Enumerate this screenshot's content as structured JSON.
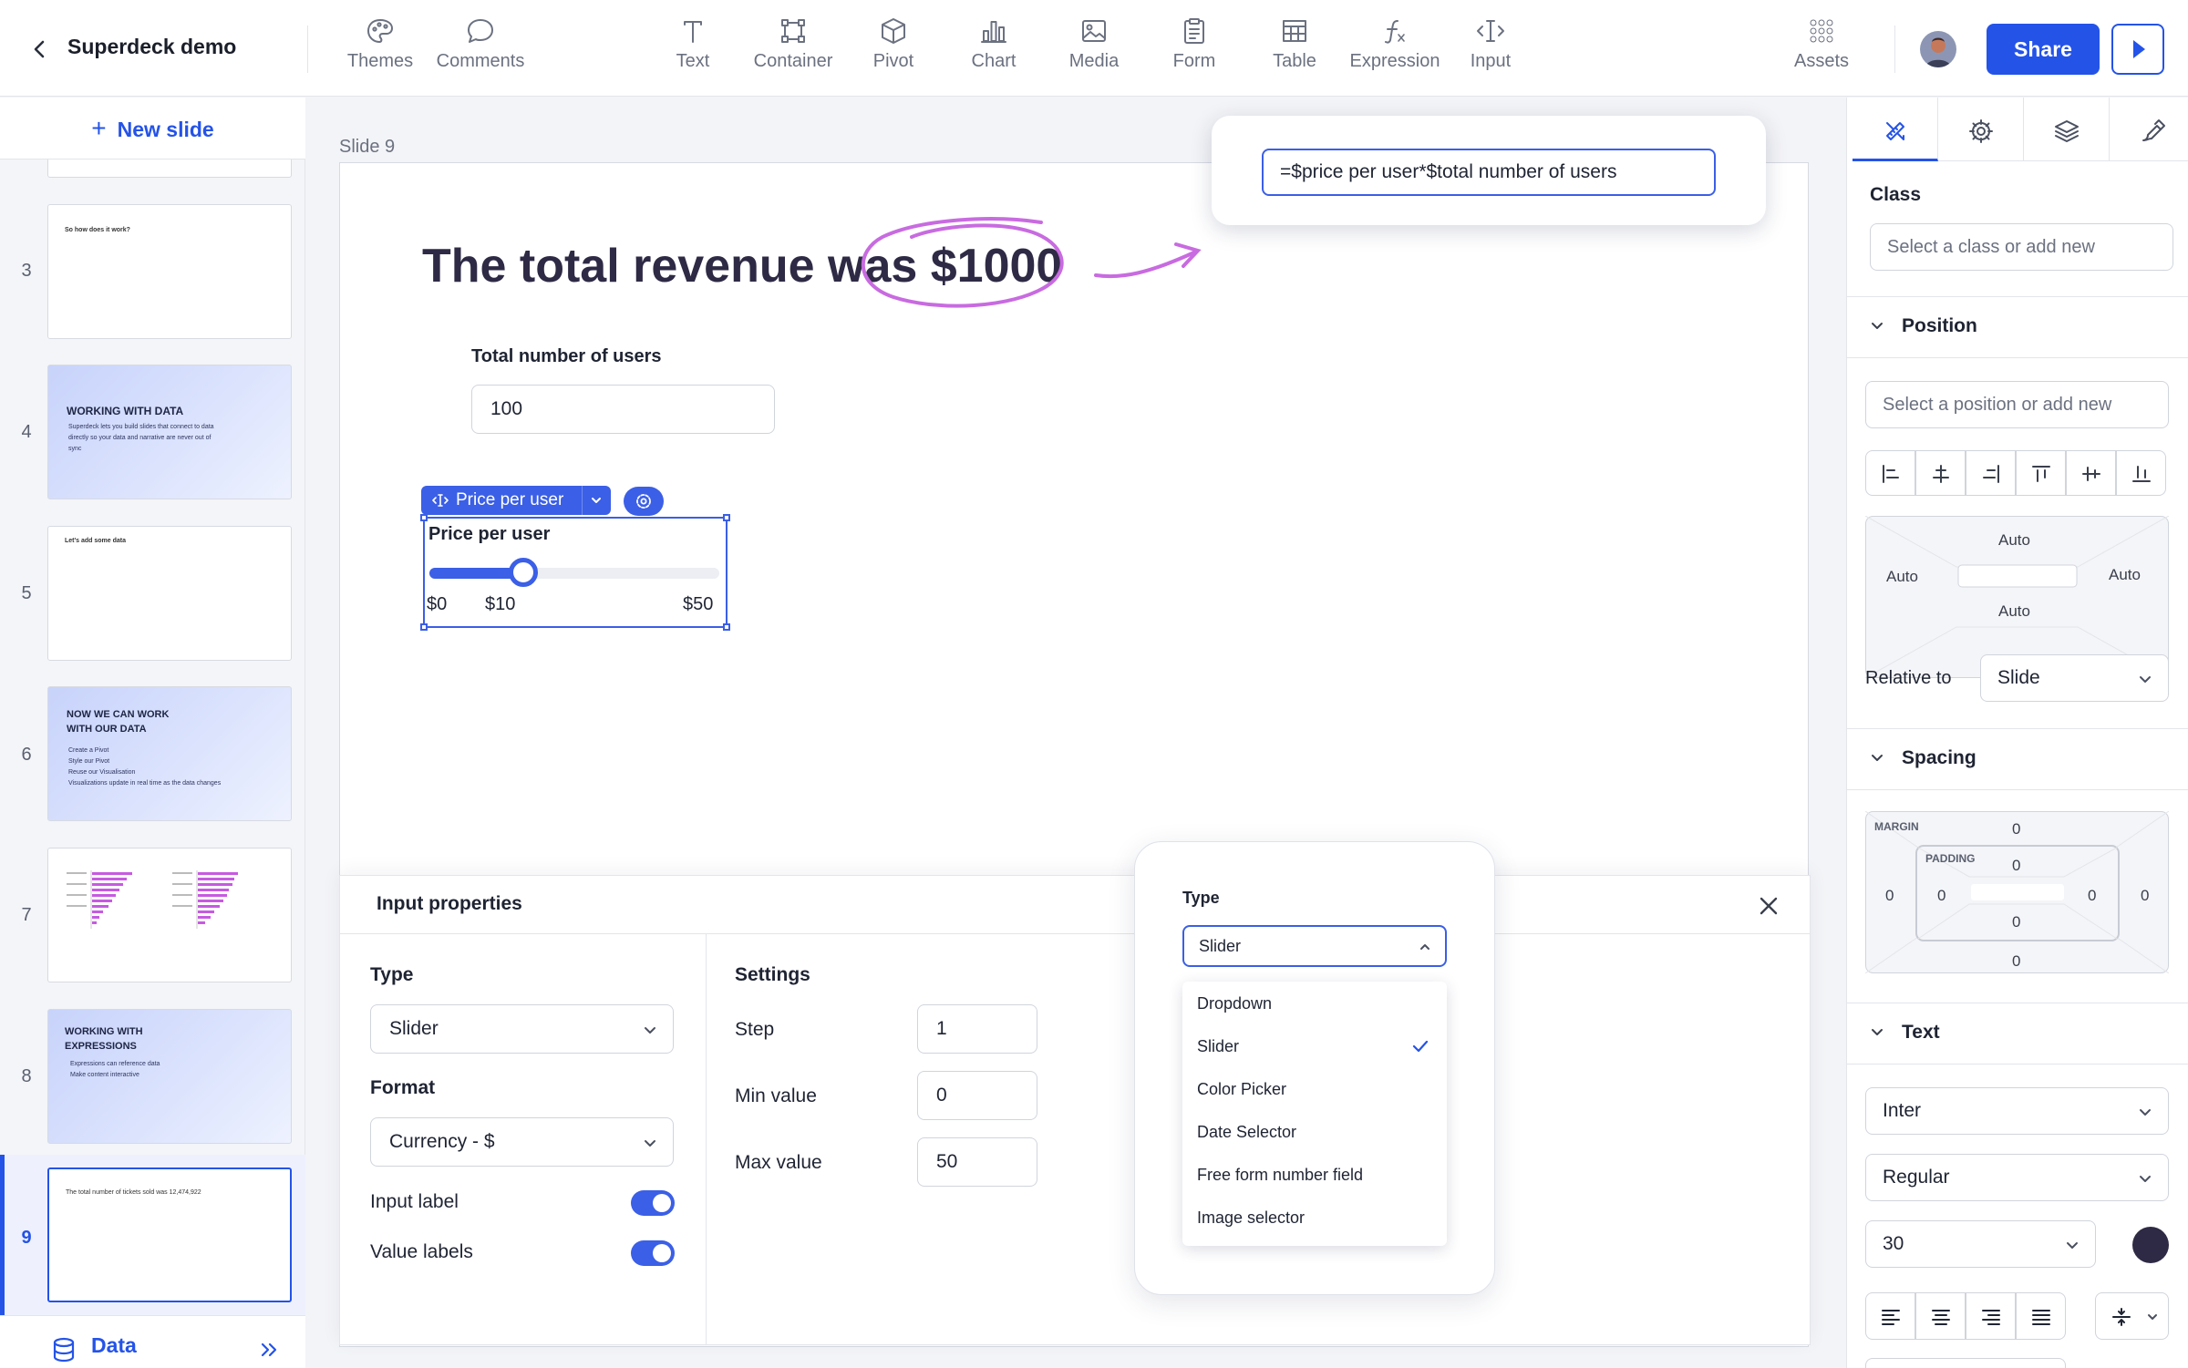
{
  "topbar": {
    "title": "Superdeck demo",
    "tools": [
      {
        "label": "Themes",
        "icon": "palette-icon"
      },
      {
        "label": "Comments",
        "icon": "comment-icon"
      },
      {
        "label": "Text",
        "icon": "text-icon"
      },
      {
        "label": "Container",
        "icon": "container-icon"
      },
      {
        "label": "Pivot",
        "icon": "cube-icon"
      },
      {
        "label": "Chart",
        "icon": "bar-chart-icon"
      },
      {
        "label": "Media",
        "icon": "image-icon"
      },
      {
        "label": "Form",
        "icon": "clipboard-icon"
      },
      {
        "label": "Table",
        "icon": "table-icon"
      },
      {
        "label": "Expression",
        "icon": "function-icon"
      },
      {
        "label": "Input",
        "icon": "text-cursor-icon"
      }
    ],
    "assets_label": "Assets",
    "share_label": "Share"
  },
  "sidebar": {
    "new_slide_label": "New slide",
    "data_label": "Data",
    "slides": [
      {
        "num": "3",
        "text": "So how does it work?"
      },
      {
        "num": "4",
        "heading": "WORKING WITH DATA",
        "body": "Superdeck lets you build slides that connect to data directly so your data and narrative are never out of sync"
      },
      {
        "num": "5",
        "text": "Let's add some data"
      },
      {
        "num": "6",
        "heading": "NOW WE CAN WORK WITH OUR DATA",
        "bullets": [
          "Create a Pivot",
          "Style our Pivot",
          "Reuse our Visualisation",
          "Visualizations update in real time as the data changes"
        ]
      },
      {
        "num": "7"
      },
      {
        "num": "8",
        "heading": "WORKING WITH EXPRESSIONS",
        "bullets": [
          "Expressions can reference data",
          "Make content interactive"
        ]
      },
      {
        "num": "9",
        "text": "The total number of tickets sold was 12,474,922"
      }
    ]
  },
  "canvas": {
    "slide_label": "Slide 9",
    "heading": "The total revenue was $1000",
    "users_label": "Total number of users",
    "users_value": "100",
    "chip_label": "Price per user",
    "slider": {
      "label": "Price per user",
      "min_label": "$0",
      "value_label": "$10",
      "max_label": "$50",
      "value": 10,
      "min": 0,
      "max": 50
    }
  },
  "formula": {
    "value": "=$price per user*$total number of users"
  },
  "props": {
    "title": "Input properties",
    "type_heading": "Type",
    "type_value": "Slider",
    "format_heading": "Format",
    "format_value": "Currency - $",
    "input_label_text": "Input label",
    "input_label_on": true,
    "value_labels_text": "Value labels",
    "value_labels_on": true,
    "settings_heading": "Settings",
    "step_label": "Step",
    "step_value": "1",
    "min_label": "Min value",
    "min_value": "0",
    "max_label": "Max value",
    "max_value": "50"
  },
  "type_dropdown": {
    "label": "Type",
    "selected": "Slider",
    "options": [
      "Dropdown",
      "Slider",
      "Color Picker",
      "Date Selector",
      "Free form number field",
      "Image selector"
    ]
  },
  "rpanel": {
    "class_heading": "Class",
    "class_placeholder": "Select a class or add new",
    "position_heading": "Position",
    "position_placeholder": "Select a position or add new",
    "auto_top": "Auto",
    "auto_left": "Auto",
    "auto_right": "Auto",
    "auto_bottom": "Auto",
    "relative_label": "Relative to",
    "relative_value": "Slide",
    "spacing_heading": "Spacing",
    "margin_label": "MARGIN",
    "padding_label": "PADDING",
    "margin": {
      "top": "0",
      "right": "0",
      "bottom": "0",
      "left": "0"
    },
    "padding": {
      "top": "0",
      "right": "0",
      "bottom": "0",
      "left": "0"
    },
    "text_heading": "Text",
    "font_value": "Inter",
    "weight_value": "Regular",
    "size_value": "30",
    "text_color": "#2e2a45"
  },
  "colors": {
    "accent": "#2453e8",
    "annotation": "#c86be0"
  }
}
